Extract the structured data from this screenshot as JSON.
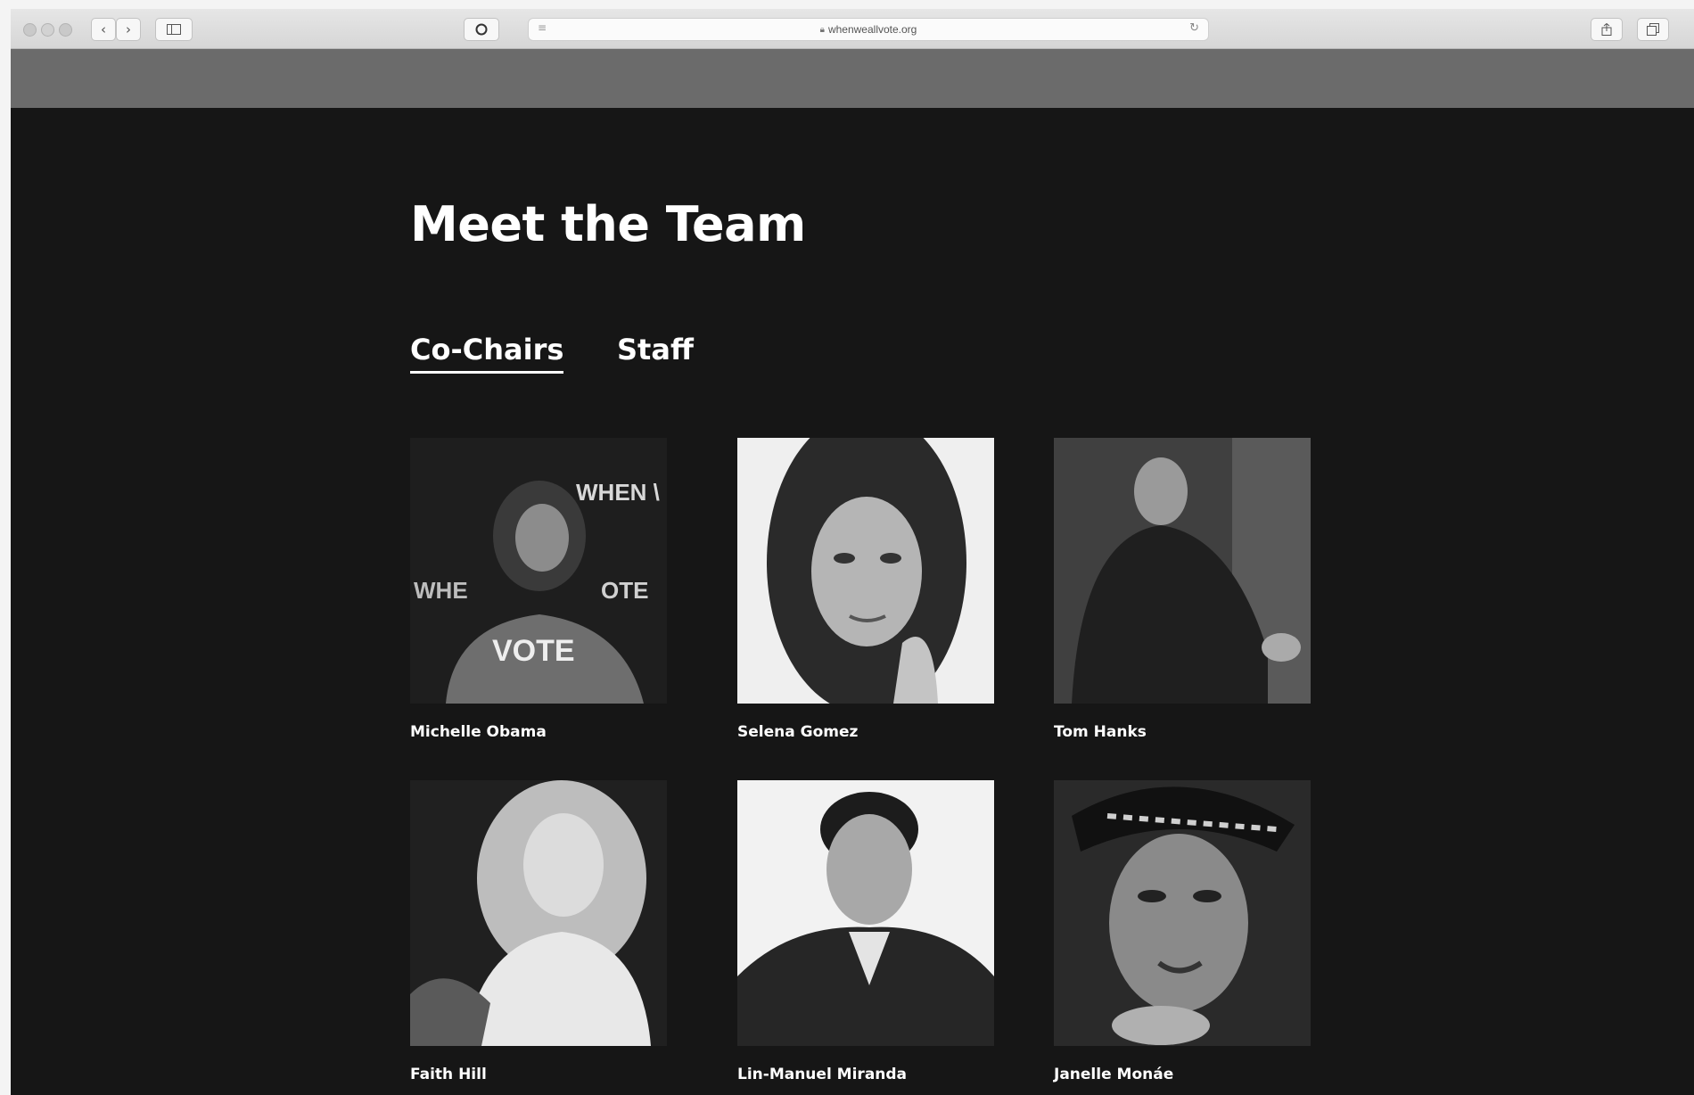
{
  "browser": {
    "url": "whenweallvote.org"
  },
  "page": {
    "title": "Meet the Team",
    "tabs": [
      {
        "label": "Co-Chairs",
        "active": true
      },
      {
        "label": "Staff",
        "active": false
      }
    ]
  },
  "team": [
    {
      "name": "Michelle Obama",
      "photo_text": [
        "WHEN \\",
        "WHE",
        "OTE",
        "VOTE"
      ]
    },
    {
      "name": "Selena Gomez"
    },
    {
      "name": "Tom Hanks"
    },
    {
      "name": "Faith Hill"
    },
    {
      "name": "Lin-Manuel Miranda"
    },
    {
      "name": "Janelle Monáe"
    }
  ]
}
